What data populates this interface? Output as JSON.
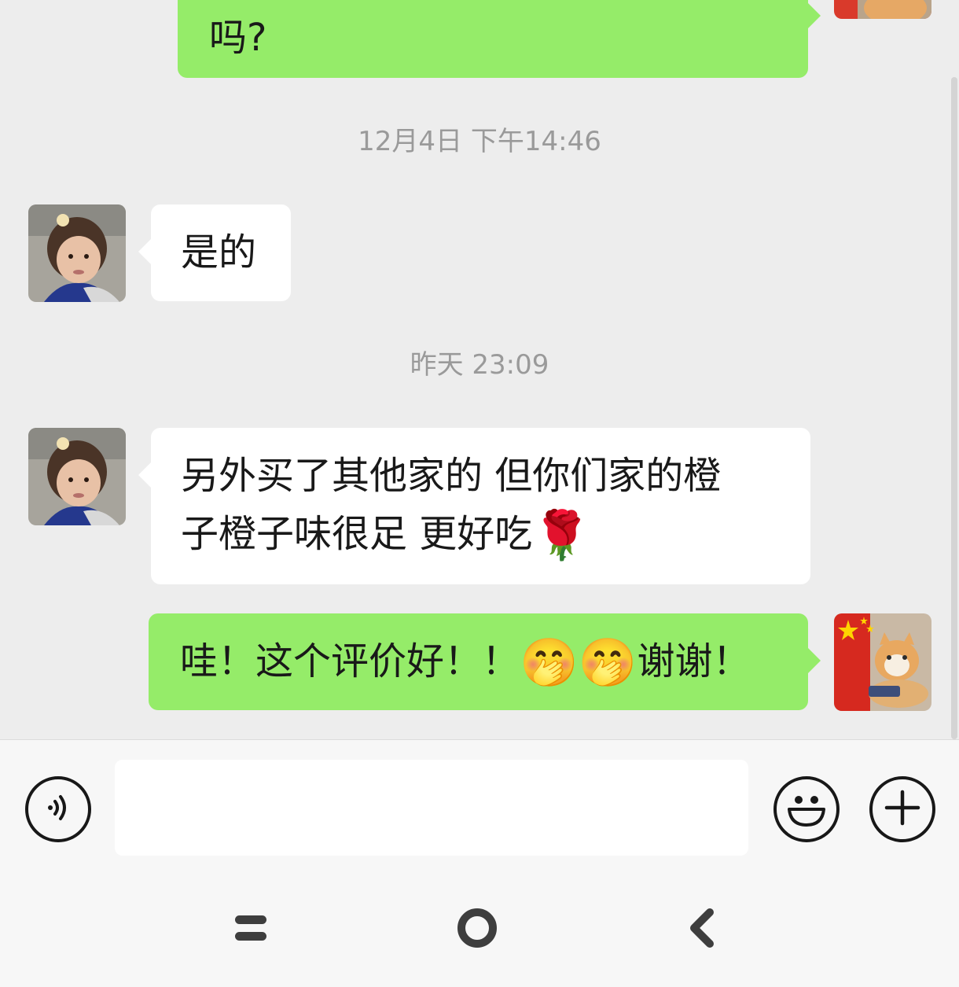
{
  "chat": {
    "messages": [
      {
        "from": "me",
        "text": "吗?"
      },
      {
        "type": "timestamp",
        "text": "12月4日 下午14:46"
      },
      {
        "from": "contact",
        "text": "是的"
      },
      {
        "type": "timestamp",
        "text": "昨天 23:09"
      },
      {
        "from": "contact",
        "line1": "另外买了其他家的 但你们家的橙",
        "line2": "子橙子味很足 更好吃",
        "emoji": "🌹"
      },
      {
        "from": "me",
        "text_a": "哇！这个评价好！！",
        "emoji_a": "🤭🤭",
        "text_b": "谢谢！"
      }
    ]
  },
  "input_bar": {
    "voice_icon": "voice-wave-icon",
    "input_placeholder": "",
    "emoji_icon": "smiley-icon",
    "plus_icon": "plus-circle-icon"
  },
  "nav": {
    "recents_icon": "recents-icon",
    "home_icon": "home-circle-icon",
    "back_icon": "back-chevron-icon"
  },
  "colors": {
    "background": "#ededed",
    "bubble_out": "#95ec69",
    "bubble_in": "#ffffff",
    "timestamp": "#9a9a9a",
    "input_bar": "#f7f7f7"
  }
}
